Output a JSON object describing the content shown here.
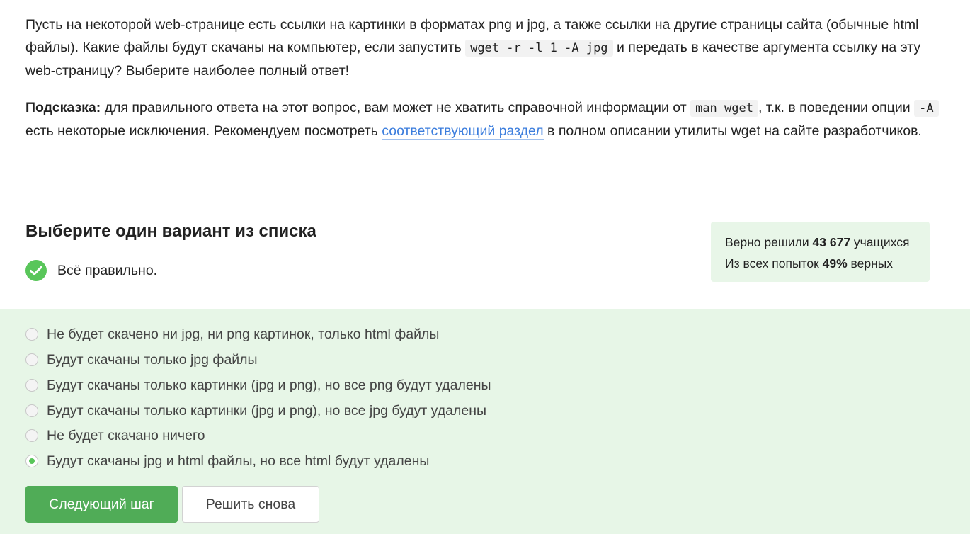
{
  "question": {
    "p1_a": "Пусть на некоторой web-странице есть ссылки на картинки в форматах png и jpg, а также ссылки на другие страницы сайта (обычные html файлы). Какие файлы будут скачаны на компьютер, если запустить ",
    "p1_code": "wget -r -l 1 -A jpg",
    "p1_b": " и передать в качестве аргумента ссылку на эту web-страницу? Выберите наиболее полный ответ!",
    "hint_label": "Подсказка:",
    "p2_a": " для правильного ответа на этот вопрос, вам может не хватить справочной информации от ",
    "p2_code1": "man wget",
    "p2_b": ", т.к. в поведении опции ",
    "p2_code2": "-A",
    "p2_c": " есть некоторые исключения. Рекомендуем посмотреть ",
    "p2_link": "соответствующий раздел",
    "p2_d": " в полном описании утилиты wget на сайте разработчиков."
  },
  "section_title": "Выберите один вариант из списка",
  "result": {
    "text": "Всё правильно."
  },
  "stats": {
    "line1_prefix": "Верно решили ",
    "line1_value": "43 677",
    "line1_suffix": " учащихся",
    "line2_prefix": "Из всех попыток ",
    "line2_value": "49%",
    "line2_suffix": " верных"
  },
  "options": [
    {
      "label": "Не будет скачено ни jpg, ни png картинок, только html файлы",
      "selected": false
    },
    {
      "label": "Будут скачаны только jpg файлы",
      "selected": false
    },
    {
      "label": "Будут скачаны только картинки (jpg и png), но все png будут удалены",
      "selected": false
    },
    {
      "label": "Будут скачаны только картинки (jpg и png), но все jpg будут удалены",
      "selected": false
    },
    {
      "label": "Не будет скачано ничего",
      "selected": false
    },
    {
      "label": "Будут скачаны jpg и html файлы, но все html будут удалены",
      "selected": true
    }
  ],
  "buttons": {
    "next": "Следующий шаг",
    "retry": "Решить снова"
  },
  "colors": {
    "accent_green": "#59c65a",
    "button_green": "#50ac57",
    "options_bg": "#e7f6e7",
    "link_blue": "#3b7ddd"
  }
}
